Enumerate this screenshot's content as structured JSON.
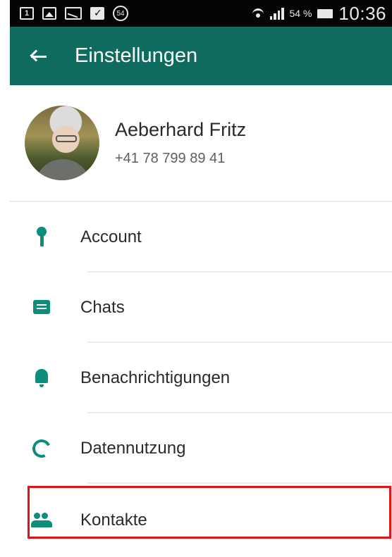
{
  "status_bar": {
    "sim_label": "1",
    "badge_count": "54",
    "battery_percent": "54 %",
    "time": "10:36"
  },
  "app_bar": {
    "title": "Einstellungen"
  },
  "profile": {
    "name": "Aeberhard Fritz",
    "phone": "+41 78 799 89 41"
  },
  "menu": {
    "items": [
      {
        "label": "Account",
        "icon": "key-icon"
      },
      {
        "label": "Chats",
        "icon": "chat-icon"
      },
      {
        "label": "Benachrichtigungen",
        "icon": "bell-icon"
      },
      {
        "label": "Datennutzung",
        "icon": "data-usage-icon"
      },
      {
        "label": "Kontakte",
        "icon": "contacts-icon"
      }
    ]
  },
  "colors": {
    "app_bar": "#0e6b5d",
    "accent": "#0e8d7a",
    "highlight": "#e31111"
  }
}
